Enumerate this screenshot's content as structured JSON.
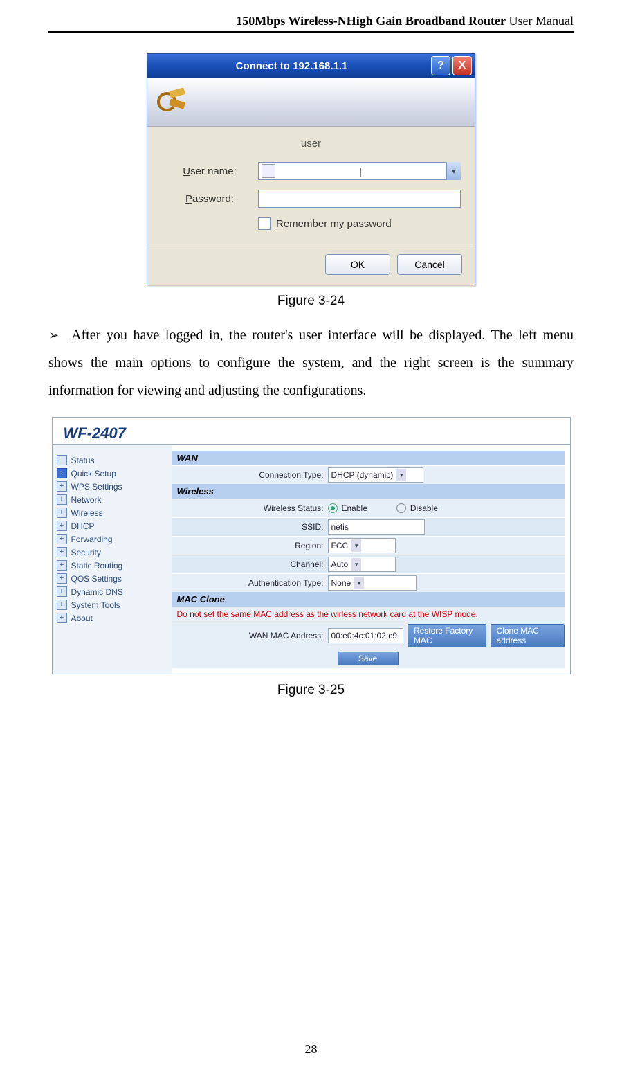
{
  "header": {
    "bold": "150Mbps Wireless-NHigh Gain Broadband Router",
    "rest": " User Manual"
  },
  "login": {
    "title": "Connect to 192.168.1.1",
    "server_label": "user",
    "username_label_pre": "U",
    "username_label_post": "ser name:",
    "username_value": "",
    "password_label_pre": "P",
    "password_label_post": "assword:",
    "password_value": "",
    "remember_pre": "R",
    "remember_post": "emember my password",
    "ok": "OK",
    "cancel": "Cancel",
    "help_glyph": "?",
    "close_glyph": "X"
  },
  "caption1": "Figure 3-24",
  "paragraph": "After you have logged in, the router's user interface will be displayed. The left menu shows the main options to configure the system, and the right screen is the summary information for viewing and adjusting the configurations.",
  "bullet": "➢",
  "router": {
    "model": "WF-2407",
    "nav": [
      "Status",
      "Quick Setup",
      "WPS Settings",
      "Network",
      "Wireless",
      "DHCP",
      "Forwarding",
      "Security",
      "Static Routing",
      "QOS Settings",
      "Dynamic DNS",
      "System Tools",
      "About"
    ],
    "sec_wan": "WAN",
    "conn_type_label": "Connection Type:",
    "conn_type_value": "DHCP (dynamic)",
    "sec_wireless": "Wireless",
    "wstatus_label": "Wireless Status:",
    "enable": "Enable",
    "disable": "Disable",
    "ssid_label": "SSID:",
    "ssid_value": "netis",
    "region_label": "Region:",
    "region_value": "FCC",
    "channel_label": "Channel:",
    "channel_value": "Auto",
    "auth_label": "Authentication Type:",
    "auth_value": "None",
    "sec_mac": "MAC Clone",
    "mac_warn": "Do not set the same MAC address as the wirless network card at the WISP mode.",
    "wan_mac_label": "WAN MAC Address:",
    "wan_mac_value": "00:e0:4c:01:02:c9",
    "btn_restore": "Restore Factory MAC",
    "btn_clone": "Clone MAC address",
    "btn_save": "Save"
  },
  "caption2": "Figure 3-25",
  "page_number": "28"
}
